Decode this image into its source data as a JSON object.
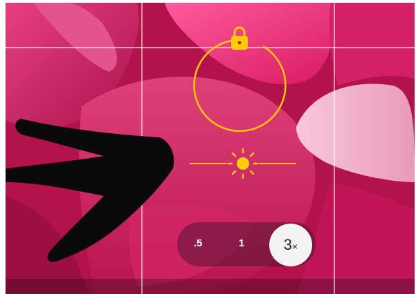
{
  "camera": {
    "zoom_options": [
      {
        "label": ".5",
        "selected": false
      },
      {
        "label": "1",
        "selected": false
      },
      {
        "label": "3",
        "suffix": "×",
        "selected": true
      }
    ],
    "focus_locked": true,
    "exposure_level": 0.5,
    "grid_enabled": true
  },
  "icons": {
    "lock": "lock-icon",
    "exposure": "sun-icon",
    "annotation": "arrow-annotation"
  },
  "colors": {
    "accent_yellow": "#ffcc00",
    "zoom_pill_bg": "#3c1428",
    "zoom_active_bg": "#f4f4f4",
    "petal_magenta": "#c2185b",
    "petal_light": "#f48fb1"
  }
}
